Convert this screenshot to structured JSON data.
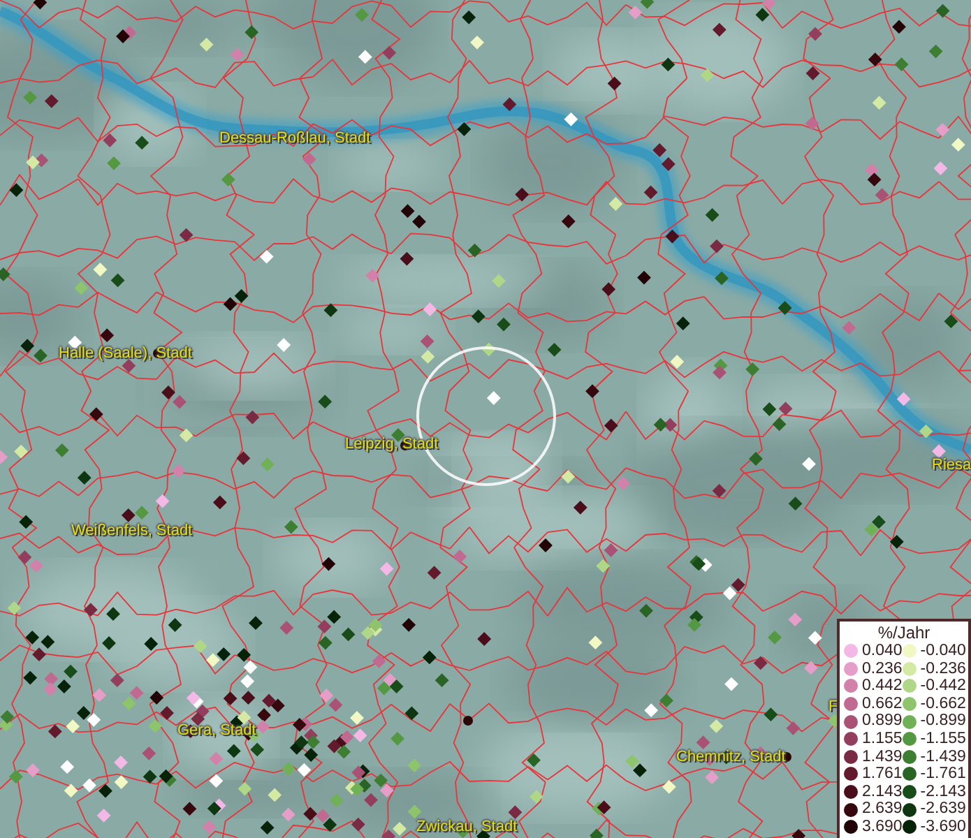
{
  "map": {
    "labels": [
      {
        "text": "Dessau-Roßlau, Stadt"
      },
      {
        "text": "Halle (Saale), Stadt"
      },
      {
        "text": "Leipzig, Stadt"
      },
      {
        "text": "Riesa"
      },
      {
        "text": "Weißenfels, Stadt"
      },
      {
        "text": "F"
      },
      {
        "text": "Gera, Stadt"
      },
      {
        "text": "Chemnitz, Stadt"
      },
      {
        "text": "Zwickau, Stadt"
      }
    ]
  },
  "legend": {
    "title": "%/Jahr",
    "rows": [
      [
        {
          "value": "0.040",
          "color": "#f4b8e6"
        },
        {
          "value": "-0.040",
          "color": "#f2f8c4"
        }
      ],
      [
        {
          "value": "0.236",
          "color": "#e49ec8"
        },
        {
          "value": "-0.236",
          "color": "#d4eaa4"
        }
      ],
      [
        {
          "value": "0.442",
          "color": "#d282aa"
        },
        {
          "value": "-0.442",
          "color": "#b0d688"
        }
      ],
      [
        {
          "value": "0.662",
          "color": "#c06a92"
        },
        {
          "value": "-0.662",
          "color": "#8ec46c"
        }
      ],
      [
        {
          "value": "0.899",
          "color": "#aa5276"
        },
        {
          "value": "-0.899",
          "color": "#70b056"
        }
      ],
      [
        {
          "value": "1.155",
          "color": "#923e5c"
        },
        {
          "value": "-1.155",
          "color": "#559842"
        }
      ],
      [
        {
          "value": "1.439",
          "color": "#7a2a42"
        },
        {
          "value": "-1.439",
          "color": "#3e7e32"
        }
      ],
      [
        {
          "value": "1.761",
          "color": "#621a2c"
        },
        {
          "value": "-1.761",
          "color": "#2a6424"
        }
      ],
      [
        {
          "value": "2.143",
          "color": "#4a0e1a"
        },
        {
          "value": "-2.143",
          "color": "#184c18"
        }
      ],
      [
        {
          "value": "2.639",
          "color": "#36080e"
        },
        {
          "value": "-2.639",
          "color": "#0e3610"
        }
      ],
      [
        {
          "value": "3.690",
          "color": "#220406"
        },
        {
          "value": "-3.690",
          "color": "#062208"
        }
      ]
    ]
  }
}
